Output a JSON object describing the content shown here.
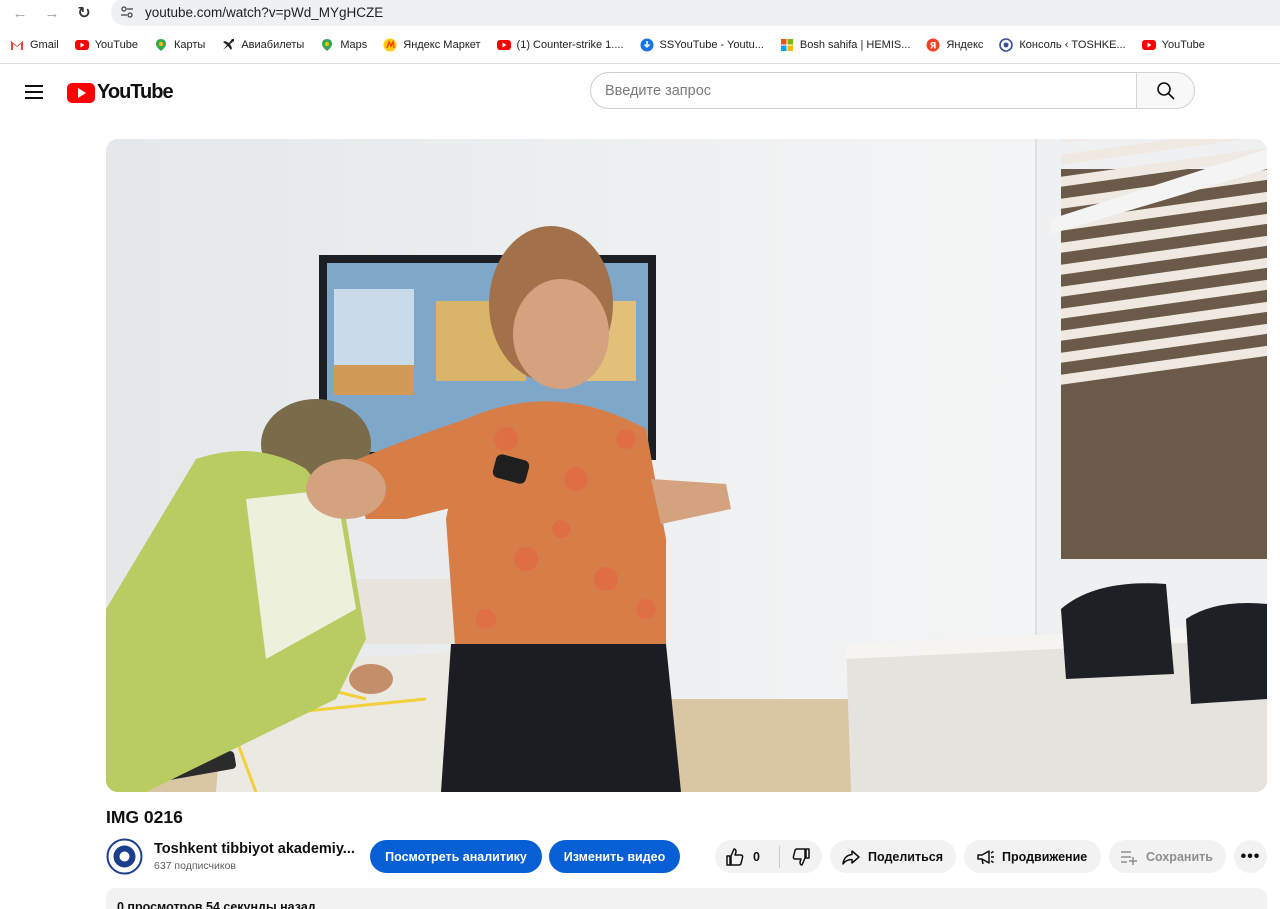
{
  "browser": {
    "url": "youtube.com/watch?v=pWd_MYgHCZE",
    "bookmarks": [
      {
        "label": "Gmail",
        "icon": "gmail-icon",
        "color": "#ea4335"
      },
      {
        "label": "YouTube",
        "icon": "youtube-icon",
        "color": "#ff0000"
      },
      {
        "label": "Карты",
        "icon": "maps-pin-icon",
        "color": "#34a853"
      },
      {
        "label": "Авиабилеты",
        "icon": "plane-icon",
        "color": "#222222"
      },
      {
        "label": "Maps",
        "icon": "maps-pin-icon",
        "color": "#34a853"
      },
      {
        "label": "Яндекс Маркет",
        "icon": "yandex-market-icon",
        "color": "#fc3f1d"
      },
      {
        "label": "(1) Counter-strike 1....",
        "icon": "youtube-icon",
        "color": "#ff0000"
      },
      {
        "label": "SSYouTube - Youtu...",
        "icon": "download-icon",
        "color": "#1a73e8"
      },
      {
        "label": "Bosh sahifa | HEMIS...",
        "icon": "microsoft-icon",
        "color": "#f25022"
      },
      {
        "label": "Яндекс",
        "icon": "yandex-icon",
        "color": "#fc3f1d"
      },
      {
        "label": "Консоль ‹ TOSHKE...",
        "icon": "globe-icon",
        "color": "#3c4b9c"
      },
      {
        "label": "YouTube",
        "icon": "youtube-icon",
        "color": "#ff0000"
      }
    ]
  },
  "masthead": {
    "logo_text": "YouTube",
    "search_placeholder": "Введите запрос"
  },
  "video": {
    "title": "IMG 0216"
  },
  "channel": {
    "name": "Toshkent tibbiyot akademiy...",
    "subscribers": "637 подписчиков"
  },
  "actions": {
    "analytics": "Посмотреть аналитику",
    "edit": "Изменить видео",
    "like_count": "0",
    "share": "Поделиться",
    "promote": "Продвижение",
    "save": "Сохранить",
    "more": "•••"
  },
  "description": {
    "meta": "0 просмотров  54 секунды назад"
  },
  "colors": {
    "accent_blue": "#065fd4",
    "youtube_red": "#ff0000",
    "pill_bg": "#f2f2f2"
  }
}
